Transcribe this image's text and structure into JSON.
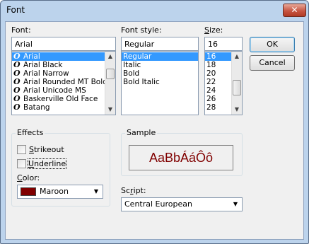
{
  "window": {
    "title": "Font",
    "close_glyph": "✕"
  },
  "font": {
    "label": "Font:",
    "value": "Arial",
    "items": [
      "Arial",
      "Arial Black",
      "Arial Narrow",
      "Arial Rounded MT Bold",
      "Arial Unicode MS",
      "Baskerville Old Face",
      "Batang"
    ],
    "item_icon": "O"
  },
  "style": {
    "label": "Font style:",
    "value": "Regular",
    "items": [
      "Regular",
      "Italic",
      "Bold",
      "Bold Italic"
    ]
  },
  "size": {
    "label": "Size:",
    "value": "16",
    "items": [
      "16",
      "18",
      "20",
      "22",
      "24",
      "26",
      "28"
    ]
  },
  "buttons": {
    "ok": "OK",
    "cancel": "Cancel"
  },
  "effects": {
    "title": "Effects",
    "strikeout": "Strikeout",
    "underline": "Underline",
    "color_label": "Color:",
    "color_value": "Maroon",
    "color_hex": "#800000"
  },
  "sample": {
    "title": "Sample",
    "text": "AaBbÁáÔô",
    "color": "#800000"
  },
  "script": {
    "label": "Script:",
    "value": "Central European"
  },
  "icons": {
    "scroll_up": "▲",
    "scroll_down": "▼",
    "dropdown": "▼"
  }
}
